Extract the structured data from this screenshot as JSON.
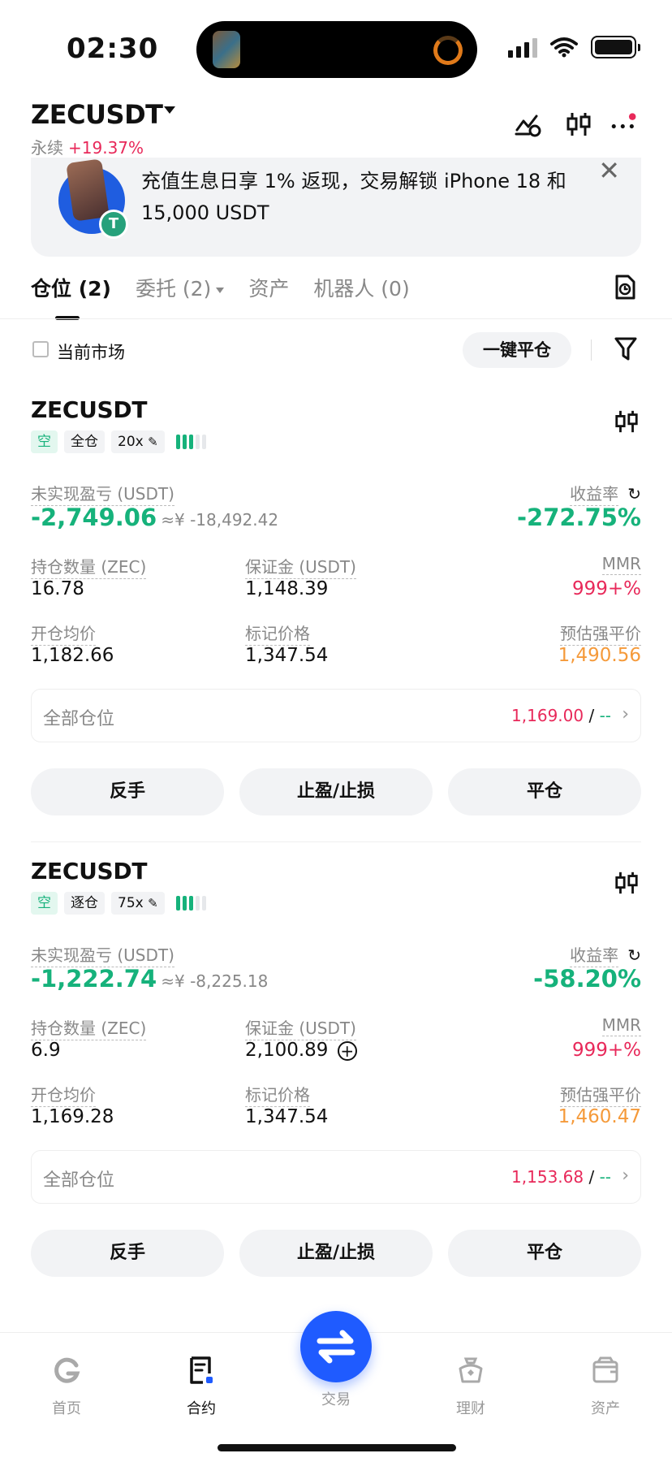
{
  "status_bar": {
    "time": "02:30"
  },
  "header": {
    "symbol": "ZECUSDT",
    "type": "永续",
    "change": "+19.37%"
  },
  "banner": {
    "text": "充值生息日享 1% 返现，交易解锁 iPhone 18 和 15,000 USDT",
    "close": "✕"
  },
  "tabs": [
    {
      "label": "仓位 (2)"
    },
    {
      "label": "委托 (2)"
    },
    {
      "label": "资产"
    },
    {
      "label": "机器人 (0)"
    }
  ],
  "filter": {
    "checkbox_label": "当前市场",
    "close_all": "一键平仓"
  },
  "positions": [
    {
      "symbol": "ZECUSDT",
      "side": "空",
      "margin_mode": "全仓",
      "leverage": "20x",
      "pnl_label": "未实现盈亏 (USDT)",
      "pnl": "-2,749.06",
      "pnl_cny": "≈¥ -18,492.42",
      "roe_label": "收益率",
      "roe": "-272.75%",
      "qty_label": "持仓数量 (ZEC)",
      "qty": "16.78",
      "margin_label": "保证金 (USDT)",
      "margin": "1,148.39",
      "mmr_label": "MMR",
      "mmr": "999+%",
      "entry_label": "开仓均价",
      "entry": "1,182.66",
      "mark_label": "标记价格",
      "mark": "1,347.54",
      "liq_label": "预估强平价",
      "liq": "1,490.56",
      "all_label": "全部仓位",
      "tp": "1,169.00",
      "sep": "/",
      "sl": "--",
      "btn_reverse": "反手",
      "btn_tpsl": "止盈/止损",
      "btn_close": "平仓"
    },
    {
      "symbol": "ZECUSDT",
      "side": "空",
      "margin_mode": "逐仓",
      "leverage": "75x",
      "pnl_label": "未实现盈亏 (USDT)",
      "pnl": "-1,222.74",
      "pnl_cny": "≈¥ -8,225.18",
      "roe_label": "收益率",
      "roe": "-58.20%",
      "qty_label": "持仓数量 (ZEC)",
      "qty": "6.9",
      "margin_label": "保证金 (USDT)",
      "margin": "2,100.89",
      "mmr_label": "MMR",
      "mmr": "999+%",
      "entry_label": "开仓均价",
      "entry": "1,169.28",
      "mark_label": "标记价格",
      "mark": "1,347.54",
      "liq_label": "预估强平价",
      "liq": "1,460.47",
      "all_label": "全部仓位",
      "tp": "1,153.68",
      "sep": "/",
      "sl": "--",
      "btn_reverse": "反手",
      "btn_tpsl": "止盈/止损",
      "btn_close": "平仓"
    }
  ],
  "nav": [
    {
      "label": "首页",
      "icon": "home-icon"
    },
    {
      "label": "合约",
      "icon": "futures-icon"
    },
    {
      "label": "交易",
      "icon": "swap-icon"
    },
    {
      "label": "理财",
      "icon": "earn-icon"
    },
    {
      "label": "资产",
      "icon": "wallet-icon"
    }
  ],
  "colors": {
    "green": "#16b27b",
    "red": "#e8295a",
    "orange": "#f59a3a",
    "blue": "#1f5bff"
  }
}
